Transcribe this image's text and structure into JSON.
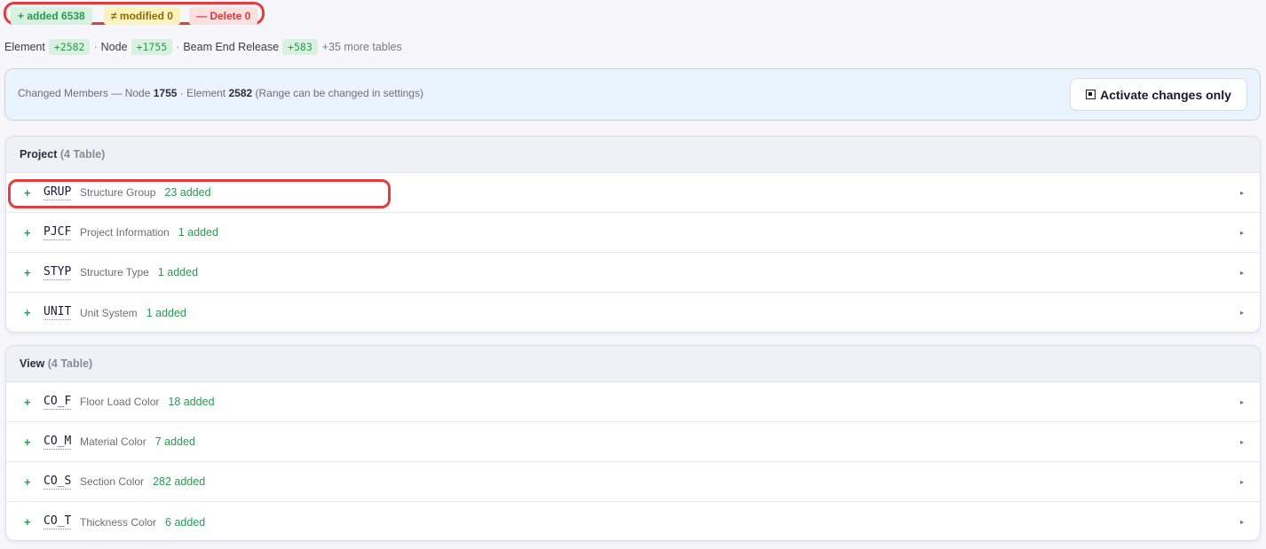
{
  "summary": {
    "added": "+ added 6538",
    "modified": "≠ modified 0",
    "deleted": "— Delete 0"
  },
  "chips": {
    "element_label": "Element",
    "element_count": "+2582",
    "node_label": "Node",
    "node_count": "+1755",
    "beam_label": "Beam End Release",
    "beam_count": "+583",
    "sep": "·",
    "more": "+35 more tables"
  },
  "info": {
    "prefix": "Changed Members — Node ",
    "node_count": "1755",
    "middle": " · Element ",
    "element_count": "2582",
    "suffix": " (Range can be changed in settings)",
    "button_label": "Activate changes only"
  },
  "sections": [
    {
      "title": "Project",
      "count": "(4 Table)",
      "rows": [
        {
          "plus": "+",
          "code": "GRUP",
          "desc": "Structure Group",
          "status": "23 added",
          "arrow": "▸"
        },
        {
          "plus": "+",
          "code": "PJCF",
          "desc": "Project Information",
          "status": "1 added",
          "arrow": "▸"
        },
        {
          "plus": "+",
          "code": "STYP",
          "desc": "Structure Type",
          "status": "1 added",
          "arrow": "▸"
        },
        {
          "plus": "+",
          "code": "UNIT",
          "desc": "Unit System",
          "status": "1 added",
          "arrow": "▸"
        }
      ]
    },
    {
      "title": "View",
      "count": "(4 Table)",
      "rows": [
        {
          "plus": "+",
          "code": "CO_F",
          "desc": "Floor Load Color",
          "status": "18 added",
          "arrow": "▸"
        },
        {
          "plus": "+",
          "code": "CO_M",
          "desc": "Material Color",
          "status": "7 added",
          "arrow": "▸"
        },
        {
          "plus": "+",
          "code": "CO_S",
          "desc": "Section Color",
          "status": "282 added",
          "arrow": "▸"
        },
        {
          "plus": "+",
          "code": "CO_T",
          "desc": "Thickness Color",
          "status": "6 added",
          "arrow": "▸"
        }
      ]
    }
  ],
  "colors": {
    "added": "#2b9a52",
    "added_bg": "#d8f2df",
    "modified_bg": "#fbf2bf",
    "deleted": "#d63b3b",
    "highlight": "#e43d3d",
    "info_bg": "#eaf4ff"
  }
}
